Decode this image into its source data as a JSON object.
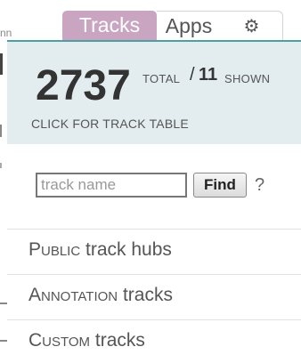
{
  "background": {
    "fragment_text": "nn"
  },
  "tabs": [
    {
      "label": "Tracks",
      "active": true
    },
    {
      "label": "Apps",
      "active": false
    },
    {
      "label": "⚙",
      "icon": "gear-icon",
      "active": false
    }
  ],
  "stats": {
    "total": "2737",
    "total_label": "TOTAL",
    "separator": "/",
    "shown": "11",
    "shown_label": "SHOWN",
    "link_label": "CLICK FOR TRACK TABLE"
  },
  "search": {
    "placeholder": "track name",
    "value": "",
    "button_label": "Find",
    "help_label": "?"
  },
  "menu": [
    {
      "label_main": "Public",
      "label_rest": "track hubs"
    },
    {
      "label_main": "Annotation",
      "label_rest": "tracks"
    },
    {
      "label_main": "Custom",
      "label_rest": "tracks"
    }
  ],
  "colors": {
    "active_tab": "#c9a5c2",
    "accent_rule": "#4f9ea0",
    "stats_background": "#e3edef"
  }
}
